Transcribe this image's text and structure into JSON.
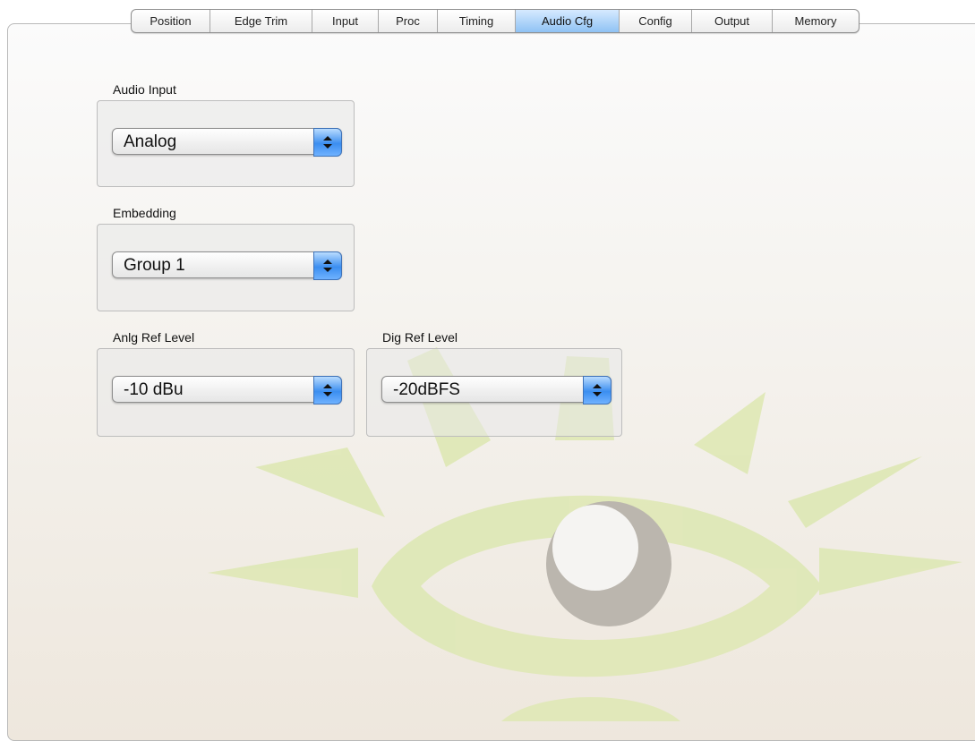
{
  "tabs": [
    {
      "label": "Position",
      "active": false
    },
    {
      "label": "Edge Trim",
      "active": false
    },
    {
      "label": "Input",
      "active": false
    },
    {
      "label": "Proc",
      "active": false
    },
    {
      "label": "Timing",
      "active": false
    },
    {
      "label": "Audio Cfg",
      "active": true
    },
    {
      "label": "Config",
      "active": false
    },
    {
      "label": "Output",
      "active": false
    },
    {
      "label": "Memory",
      "active": false
    }
  ],
  "audio_input": {
    "label": "Audio Input",
    "value": "Analog"
  },
  "embedding": {
    "label": "Embedding",
    "value": "Group 1"
  },
  "anlg_ref_level": {
    "label": "Anlg Ref Level",
    "value": "-10 dBu"
  },
  "dig_ref_level": {
    "label": "Dig Ref Level",
    "value": "-20dBFS"
  },
  "colors": {
    "accent": "#5aa2f2",
    "watermark_green": "#dfe7b4",
    "watermark_gray": "#b9b4ad"
  }
}
